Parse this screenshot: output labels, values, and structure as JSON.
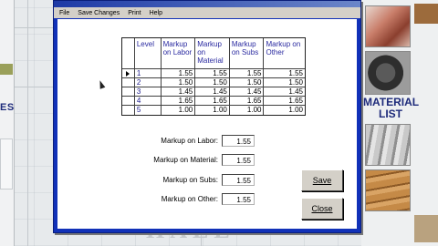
{
  "background": {
    "left_text": "ES",
    "right_text": "MATERIAL LIST",
    "bottom_text": "HALL"
  },
  "dialog": {
    "menu": [
      "File",
      "Save Changes",
      "Print",
      "Help"
    ],
    "table": {
      "headers": [
        "Level",
        "Markup on Labor",
        "Markup on Material",
        "Markup on Subs",
        "Markup on Other"
      ],
      "rows": [
        {
          "level": "1",
          "labor": "1.55",
          "material": "1.55",
          "subs": "1.55",
          "other": "1.55",
          "selected": true
        },
        {
          "level": "2",
          "labor": "1.50",
          "material": "1.50",
          "subs": "1.50",
          "other": "1.50",
          "selected": false
        },
        {
          "level": "3",
          "labor": "1.45",
          "material": "1.45",
          "subs": "1.45",
          "other": "1.45",
          "selected": false
        },
        {
          "level": "4",
          "labor": "1.65",
          "material": "1.65",
          "subs": "1.65",
          "other": "1.65",
          "selected": false
        },
        {
          "level": "5",
          "labor": "1.00",
          "material": "1.00",
          "subs": "1.00",
          "other": "1.00",
          "selected": false
        }
      ]
    },
    "fields": {
      "labor": {
        "label": "Markup on Labor:",
        "value": "1.55"
      },
      "material": {
        "label": "Markup on Material:",
        "value": "1.55"
      },
      "subs": {
        "label": "Markup on Subs:",
        "value": "1.55"
      },
      "other": {
        "label": "Markup on Other:",
        "value": "1.55"
      }
    },
    "buttons": {
      "save": "Save",
      "close": "Close"
    }
  }
}
